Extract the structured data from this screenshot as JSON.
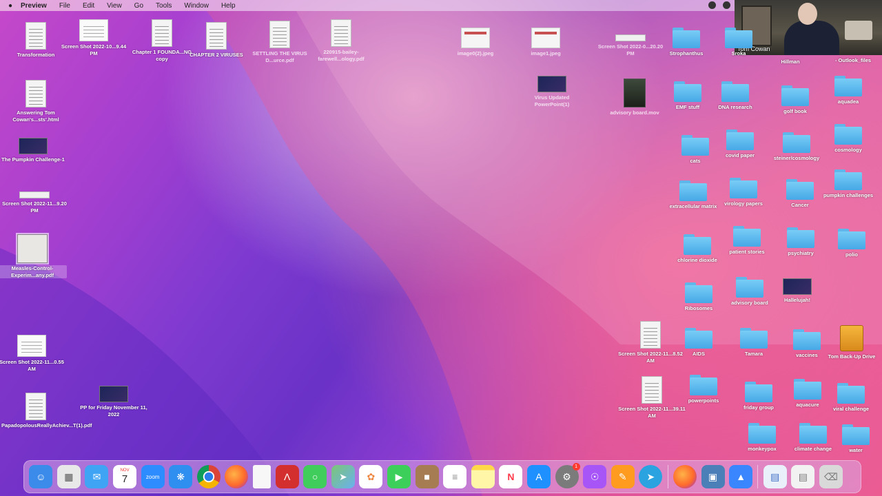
{
  "menubar": {
    "apple": "",
    "app": "Preview",
    "menus": [
      "File",
      "Edit",
      "View",
      "Go",
      "Tools",
      "Window",
      "Help"
    ]
  },
  "webcam": {
    "name": "Tom Cowan"
  },
  "desktop_files": [
    {
      "label": "Transformation"
    },
    {
      "label": "Screen Shot 2022-10...9.44 PM"
    },
    {
      "label": "Chapter 1 FOUNDA...NG copy"
    },
    {
      "label": "CHAPTER 2 VIRUSES"
    },
    {
      "label": "SETTLING THE VIRUS D...urce.pdf"
    },
    {
      "label": "220915-bailey-farewell...ology.pdf"
    },
    {
      "label": "image0(2).jpeg"
    },
    {
      "label": "image1.jpeg"
    },
    {
      "label": "Screen Shot 2022-0...20.20 PM"
    },
    {
      "label": "Virus Updated PowerPoint(1)"
    },
    {
      "label": "advisory board.mov"
    },
    {
      "label": "Answering Tom Cowan's...sts'.html"
    },
    {
      "label": "The Pumpkin Challenge-1"
    },
    {
      "label": "Screen Shot 2022-11...9.20 PM"
    },
    {
      "label": "Measles-Control-Experim...any.pdf"
    },
    {
      "label": "Screen Shot 2022-11...0.55 AM"
    },
    {
      "label": "PP for Friday November 11, 2022"
    },
    {
      "label": "PapadopolousReallyAchiev...T(1).pdf"
    },
    {
      "label": "Screen Shot 2022-11...8.52 AM"
    },
    {
      "label": "Screen Shot 2022-11...39.11 AM"
    },
    {
      "label": "Hallelujah!"
    },
    {
      "label": "Tom Back-Up Drive"
    }
  ],
  "folders": [
    {
      "label": "Strophanthus"
    },
    {
      "label": "Sroka"
    },
    {
      "label": "Hillman"
    },
    {
      "label": "- Outlook_files"
    },
    {
      "label": "EMF stuff"
    },
    {
      "label": "DNA research"
    },
    {
      "label": "golf book"
    },
    {
      "label": "aquadea"
    },
    {
      "label": "cats"
    },
    {
      "label": "covid paper"
    },
    {
      "label": "steiner/cosmology"
    },
    {
      "label": "cosmology"
    },
    {
      "label": "extracellular matrix"
    },
    {
      "label": "virology papers"
    },
    {
      "label": "Cancer"
    },
    {
      "label": "pumpkin challenges"
    },
    {
      "label": "chlorine dioxide"
    },
    {
      "label": "patient stories"
    },
    {
      "label": "psychiatry"
    },
    {
      "label": "polio"
    },
    {
      "label": "Ribosomes"
    },
    {
      "label": "advisory board"
    },
    {
      "label": "AIDS"
    },
    {
      "label": "Tamara"
    },
    {
      "label": "vaccines"
    },
    {
      "label": "powerpoints"
    },
    {
      "label": "friday group"
    },
    {
      "label": "aquacure"
    },
    {
      "label": "viral challenge"
    },
    {
      "label": "monkeypox"
    },
    {
      "label": "climate change"
    },
    {
      "label": "water"
    }
  ],
  "dock": {
    "calendar": {
      "month": "NOV",
      "day": "7"
    },
    "zoom": "zoom",
    "settings_badge": "1",
    "colors": {
      "finder": "#3b8bea",
      "launchpad": "#e8e8e8",
      "mail": "#3fa4f4",
      "calendar": "#ffffff",
      "zoom": "#2d8cff",
      "safari": "#2f8ff0",
      "chrome": "#ffffff",
      "firefox": "#ff7a2c",
      "file": "#f7f7f7",
      "acrobat": "#d32f2f",
      "messages": "#40cd5c",
      "maps": "#7cc576",
      "photos": "#ffffff",
      "facetime": "#3ccf59",
      "archive": "#a67c52",
      "reminders": "#ffffff",
      "notes": "#fff6a8",
      "news": "#ff3a4a",
      "appstore": "#1e90ff",
      "settings": "#7b7b7b",
      "podcasts": "#a855f7",
      "pages": "#ff9b1f",
      "telegram": "#2aa3e0",
      "firefox2": "#ff7a2c",
      "preview": "#4a7fb8",
      "keynote": "#3a86ff",
      "doc1": "#e9f0fa",
      "doc2": "#f2f2f2",
      "trash": "#d9d9d9"
    }
  }
}
